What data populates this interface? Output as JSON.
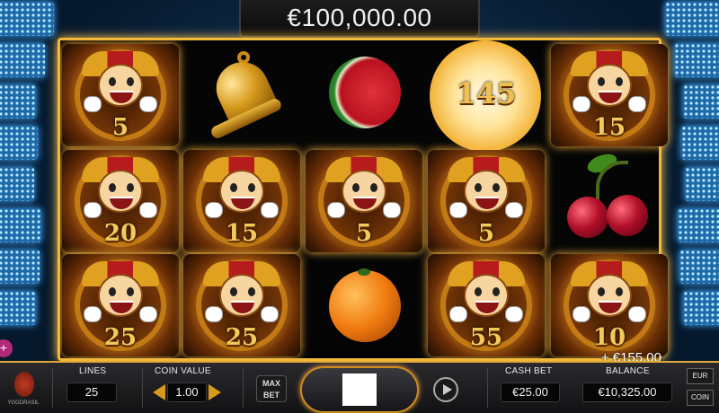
{
  "jackpot": {
    "amount": "€100,000.00"
  },
  "reels": [
    [
      {
        "symbol": "joker",
        "multiplier": "5"
      },
      {
        "symbol": "joker",
        "multiplier": "20"
      },
      {
        "symbol": "joker",
        "multiplier": "25"
      }
    ],
    [
      {
        "symbol": "bell",
        "multiplier": ""
      },
      {
        "symbol": "joker",
        "multiplier": "15"
      },
      {
        "symbol": "joker",
        "multiplier": "25"
      }
    ],
    [
      {
        "symbol": "watermelon",
        "multiplier": ""
      },
      {
        "symbol": "joker",
        "multiplier": "5"
      },
      {
        "symbol": "orange",
        "multiplier": ""
      }
    ],
    [
      {
        "symbol": "bonus",
        "multiplier": "145"
      },
      {
        "symbol": "joker",
        "multiplier": "5"
      },
      {
        "symbol": "joker",
        "multiplier": "55"
      }
    ],
    [
      {
        "symbol": "joker",
        "multiplier": "15"
      },
      {
        "symbol": "cherry",
        "multiplier": ""
      },
      {
        "symbol": "joker",
        "multiplier": "10"
      }
    ]
  ],
  "win": {
    "text": "+ €155.00"
  },
  "controls": {
    "brand": "YGGDRASIL",
    "lines_label": "LINES",
    "lines_value": "25",
    "coin_value_label": "COIN VALUE",
    "coin_value": "1.00",
    "max_bet_label_1": "MAX",
    "max_bet_label_2": "BET",
    "cash_bet_label": "CASH BET",
    "cash_bet_value": "€25.00",
    "balance_label": "BALANCE",
    "balance_value": "€10,325.00",
    "currency_eur": "EUR",
    "currency_coin": "COIN"
  },
  "icons": {
    "menu": "plus-icon",
    "spin": "stop-square-icon",
    "autoplay": "autoplay-icon",
    "coin_decrease": "arrow-left-icon",
    "coin_increase": "arrow-right-icon"
  },
  "colors": {
    "frame_gold": "#f0b93a",
    "background": "#0a1a2e",
    "menu_button": "#b02a7a"
  }
}
